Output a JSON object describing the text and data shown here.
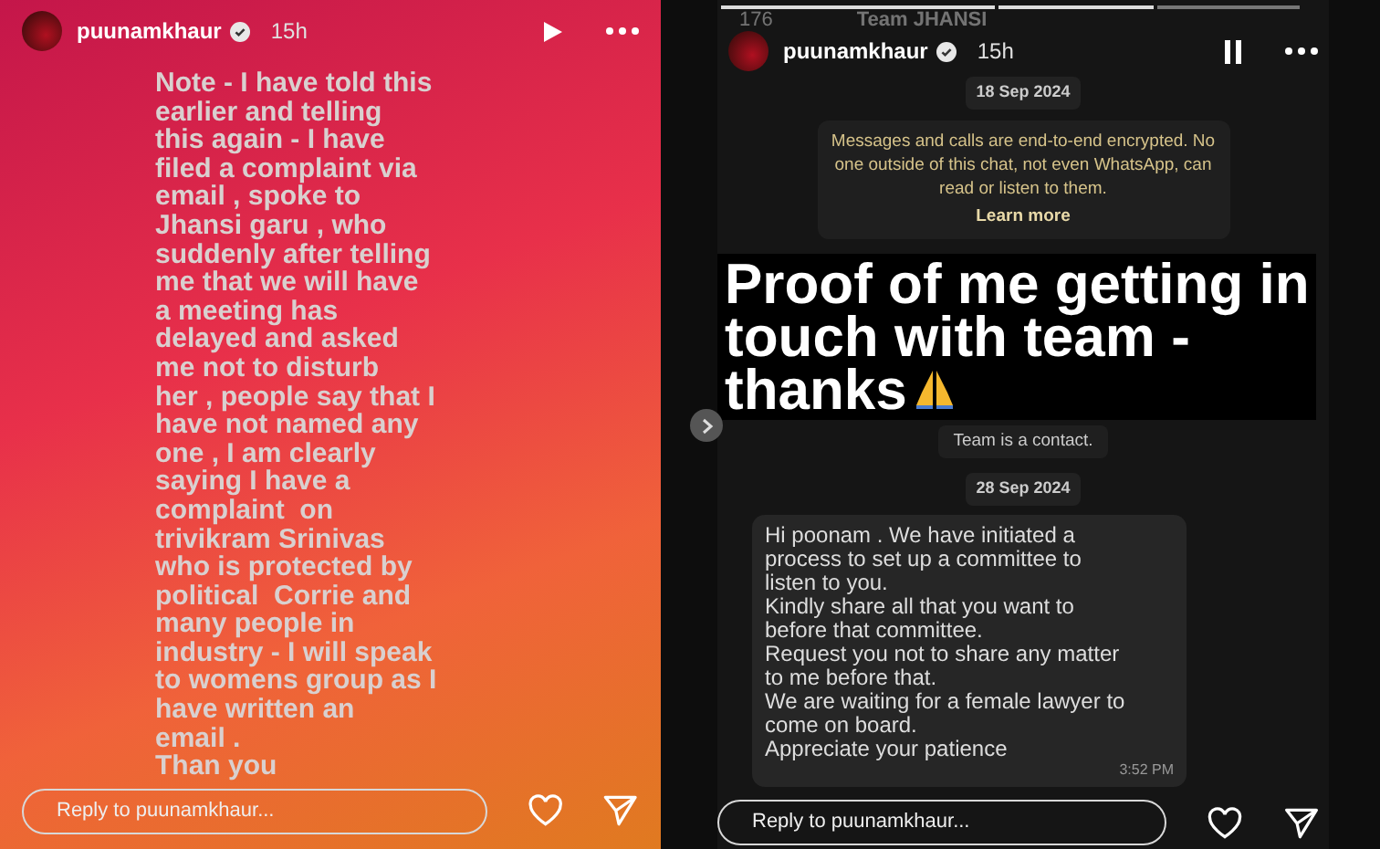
{
  "left_story": {
    "user": {
      "name": "puunamkhaur",
      "verified": true,
      "time": "15h"
    },
    "paused": true,
    "note": "Note - I have told this\nearlier and telling\nthis again - I have\nfiled a complaint via\nemail , spoke to\nJhansi garu , who\nsuddenly after telling\nme that we will have\na meeting has\ndelayed and asked\nme not to disturb\nher , people say that I\nhave not named any\none , I am clearly\nsaying I have a\ncomplaint  on\ntrivikram Srinivas\nwho is protected by\npolitical  Corrie and\nmany people in\nindustry - I will speak\nto womens group as I\nhave written an\nemail .\nThan you",
    "reply": {
      "placeholder": "Reply to puunamkhaur..."
    }
  },
  "right_story": {
    "chat_header": {
      "back_count": "176",
      "contact": "Team JHANSI"
    },
    "user": {
      "name": "puunamkhaur",
      "verified": true,
      "time": "15h"
    },
    "paused": false,
    "date_1": "18 Sep 2024",
    "notice": {
      "text": "Messages and calls are end-to-end encrypted. No one outside of this chat, not even WhatsApp, can read or listen to them.",
      "link": "Learn more"
    },
    "overlay_caption": "Proof of me getting in\ntouch with team -\nthanks",
    "system_message": "Team is a contact.",
    "date_2": "28 Sep 2024",
    "message": {
      "lines": [
        "Hi poonam . We have initiated a",
        "process to set up a committee to",
        "listen to you.",
        "Kindly share all that you want to",
        "before that committee.",
        "Request you not to share any matter",
        "to me before that.",
        "We are waiting for a female lawyer to",
        "come on board.",
        "Appreciate your patience"
      ],
      "time": "3:52 PM"
    },
    "reply": {
      "placeholder": "Reply to puunamkhaur..."
    }
  }
}
